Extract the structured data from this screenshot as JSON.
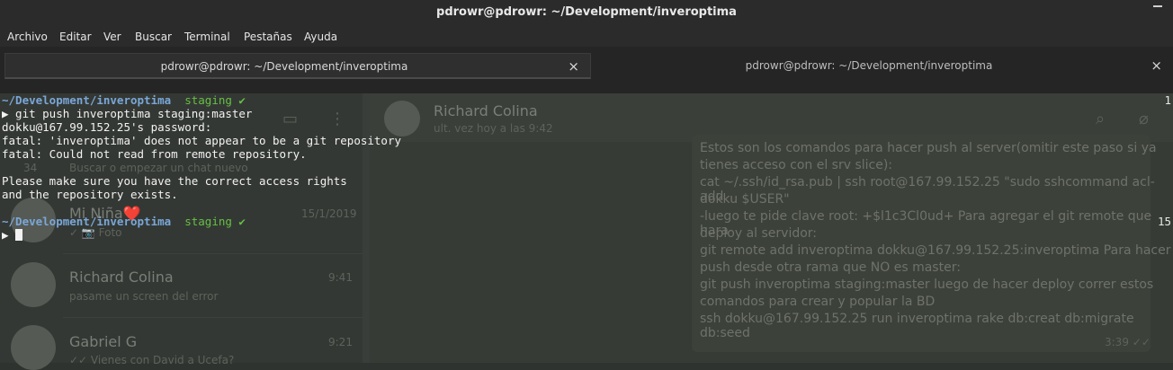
{
  "window": {
    "title": "pdrowr@pdrowr: ~/Development/inveroptima"
  },
  "menu": {
    "items": [
      "Archivo",
      "Editar",
      "Ver",
      "Buscar",
      "Terminal",
      "Pestañas",
      "Ayuda"
    ]
  },
  "tabs": [
    {
      "label": "pdrowr@pdrowr: ~/Development/inveroptima",
      "active": true,
      "close": "×"
    },
    {
      "label": "pdrowr@pdrowr: ~/Development/inveroptima",
      "active": false,
      "close": "×"
    }
  ],
  "terminal": {
    "prompt1": {
      "path": "~/Development/inveroptima",
      "branch": "staging ✔",
      "right_number": "1"
    },
    "command": "▶ git push inveroptima staging:master",
    "output": [
      "dokku@167.99.152.25's password:",
      "fatal: 'inveroptima' does not appear to be a git repository",
      "fatal: Could not read from remote repository.",
      "",
      "Please make sure you have the correct access rights",
      "and the repository exists."
    ],
    "prompt2": {
      "path": "~/Development/inveroptima",
      "branch": "staging ✔",
      "right_number": "15"
    },
    "input_prompt": "▶ "
  },
  "background": {
    "chat_contact": "Richard Colina",
    "chat_status": "ult. vez hoy a las 9:42",
    "search_placeholder": "Buscar o empezar un chat nuevo",
    "chats": [
      {
        "name": "Mi Niña❤️",
        "preview": "✓ 📷 Foto",
        "time": "15/1/2019"
      },
      {
        "name": "Richard Colina",
        "preview": "pasame un screen del error",
        "time": "9:41"
      },
      {
        "name": "Gabriel G",
        "preview": "✓✓ Vienes con David a Ucefa?",
        "time": "9:21"
      }
    ],
    "message_lines": [
      "Estos son los comandos para hacer push al server(omitir este paso si ya",
      "tienes acceso con el srv slice):",
      "cat ~/.ssh/id_rsa.pub | ssh root@167.99.152.25 \"sudo sshcommand acl-add",
      "dokku $USER\"",
      "-luego te pide clave root: +$l1c3Cl0ud+ Para agregar el git remote que hara",
      "deploy al servidor:",
      "git remote add inveroptima dokku@167.99.152.25:inveroptima Para hacer",
      "push desde otra rama que NO es master:",
      "git push inveroptima staging:master luego de hacer deploy correr estos",
      "comandos para crear y popular la BD",
      "ssh dokku@167.99.152.25 run inveroptima rake db:creat db:migrate db:seed"
    ],
    "message_time": "3:39 ✓✓",
    "list_time_partial": "34"
  },
  "colors": {
    "path": "#7aa7d8",
    "branch": "#66c045",
    "terminal_bg": "#2f332f"
  }
}
